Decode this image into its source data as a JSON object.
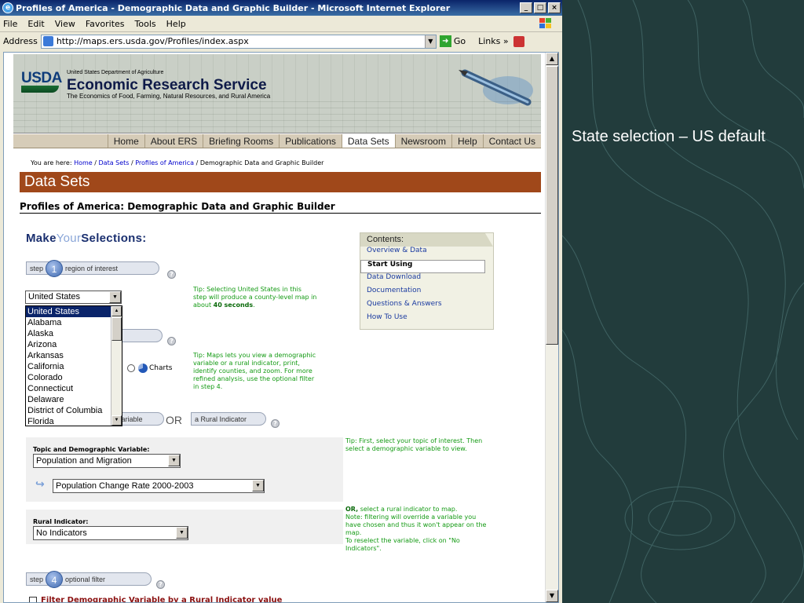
{
  "window": {
    "title": "Profiles of America - Demographic Data and Graphic Builder - Microsoft Internet Explorer",
    "minimize": "_",
    "maximize": "□",
    "close": "×"
  },
  "menu": [
    "File",
    "Edit",
    "View",
    "Favorites",
    "Tools",
    "Help"
  ],
  "address": {
    "label": "Address",
    "url": "http://maps.ers.usda.gov/Profiles/index.aspx",
    "go": "Go",
    "links": "Links »"
  },
  "header": {
    "logo_text": "USDA",
    "dept": "United States Department of Agriculture",
    "agency": "Economic Research Service",
    "tagline": "The Economics of Food, Farming, Natural Resources, and Rural America"
  },
  "nav": {
    "items": [
      "Home",
      "About ERS",
      "Briefing Rooms",
      "Publications",
      "Data Sets",
      "Newsroom",
      "Help",
      "Contact Us"
    ],
    "active": "Data Sets"
  },
  "breadcrumb": {
    "prefix": "You are here:",
    "links": [
      "Home",
      "Data Sets",
      "Profiles of America"
    ],
    "current": "Demographic Data and Graphic Builder"
  },
  "section_title": "Data Sets",
  "page_title": "Profiles of America: Demographic Data and Graphic Builder",
  "make_selections": {
    "make": "Make",
    "your": "Your",
    "selections": "Selections:"
  },
  "steps": {
    "step_word": "step",
    "step1": {
      "num": "1",
      "label": "region of interest"
    },
    "step4": {
      "num": "4",
      "label": "optional filter"
    },
    "variable_tab": "variable",
    "rural_tab": "a Rural Indicator",
    "or": "OR",
    "help": "?"
  },
  "tips": {
    "tip1_a": "Tip: Selecting United States in this",
    "tip1_b": "step will produce a county-level map in",
    "tip1_c": "about ",
    "tip1_bold": "40 seconds",
    "tip1_end": ".",
    "tip2": [
      "Tip: Maps lets you view a demographic",
      "variable or a rural indicator, print,",
      "identify counties, and zoom. For more",
      "refined analysis, use the optional filter",
      "in step 4."
    ],
    "tip3": [
      "Tip: First, select your topic of interest. Then",
      "select a demographic variable to view."
    ],
    "tip4_bold": "OR,",
    "tip4_first": " select a rural indicator to map.",
    "tip4": [
      "Note: filtering will override a variable you",
      "have chosen and thus it won't appear on the",
      "map.",
      "To reselect the variable, click on \"No",
      "Indicators\"."
    ]
  },
  "region": {
    "selected": "United States",
    "options": [
      "United States",
      "Alabama",
      "Alaska",
      "Arizona",
      "Arkansas",
      "California",
      "Colorado",
      "Connecticut",
      "Delaware",
      "District of Columbia",
      "Florida"
    ]
  },
  "charts_label": "Charts",
  "topic": {
    "label": "Topic and Demographic Variable:",
    "topic_value": "Population and Migration",
    "variable_value": "Population Change Rate 2000-2003"
  },
  "rural": {
    "label": "Rural Indicator:",
    "value": "No Indicators"
  },
  "contents": {
    "title": "Contents:",
    "items": [
      "Overview & Data",
      "Start Using",
      "Data Download",
      "Documentation",
      "Questions & Answers",
      "How To Use"
    ],
    "current": "Start Using"
  },
  "filter_label": "Filter Demographic Variable by a Rural Indicator value",
  "slide_caption": "State selection – US default"
}
